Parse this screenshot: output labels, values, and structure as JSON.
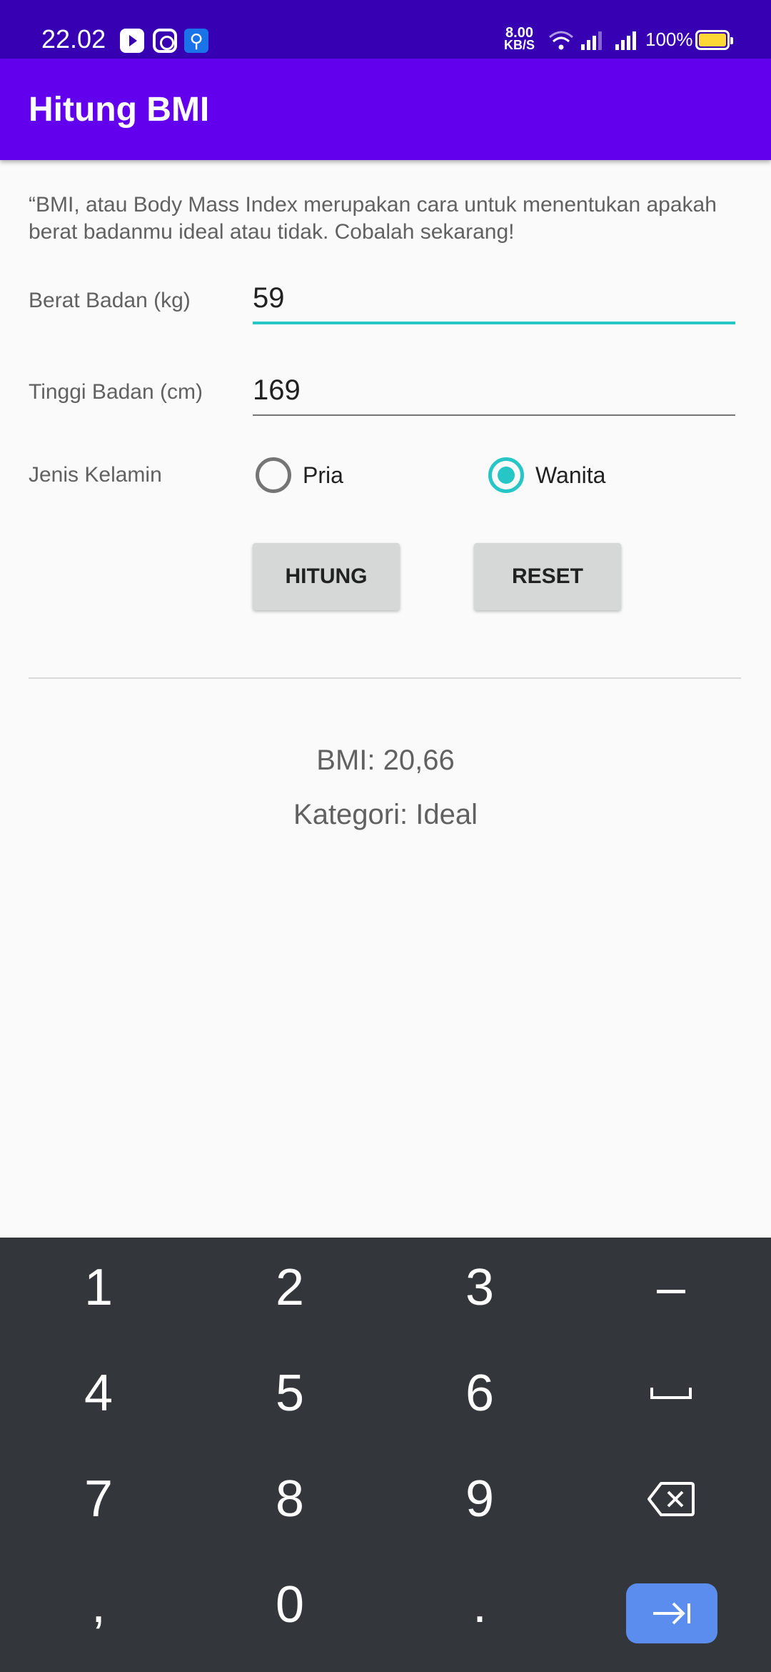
{
  "status_bar": {
    "time": "22.02",
    "net_speed_value": "8.00",
    "net_speed_unit": "KB/S",
    "battery_percent": "100%"
  },
  "app_bar": {
    "title": "Hitung BMI"
  },
  "intro_text": "“BMI, atau Body Mass Index merupakan cara untuk menentukan apakah berat badanmu ideal atau tidak. Cobalah sekarang!",
  "form": {
    "weight_label": "Berat Badan (kg)",
    "weight_value": "59",
    "height_label": "Tinggi Badan (cm)",
    "height_value": "169",
    "gender_label": "Jenis Kelamin",
    "gender_options": [
      "Pria",
      "Wanita"
    ],
    "gender_selected": "Wanita"
  },
  "buttons": {
    "calculate": "HITUNG",
    "reset": "RESET"
  },
  "result": {
    "bmi": "BMI: 20,66",
    "category": "Kategori: Ideal"
  },
  "keyboard": {
    "rows": [
      [
        "1",
        "2",
        "3",
        "–"
      ],
      [
        "4",
        "5",
        "6",
        "space-icon"
      ],
      [
        "7",
        "8",
        "9",
        "backspace-icon"
      ],
      [
        ",",
        "0",
        ".",
        "next-icon"
      ]
    ]
  },
  "colors": {
    "status_bar": "#3700b3",
    "app_bar": "#6200ee",
    "accent": "#26c6c6",
    "keyboard_bg": "#33373c",
    "enter_key": "#5b8def"
  }
}
